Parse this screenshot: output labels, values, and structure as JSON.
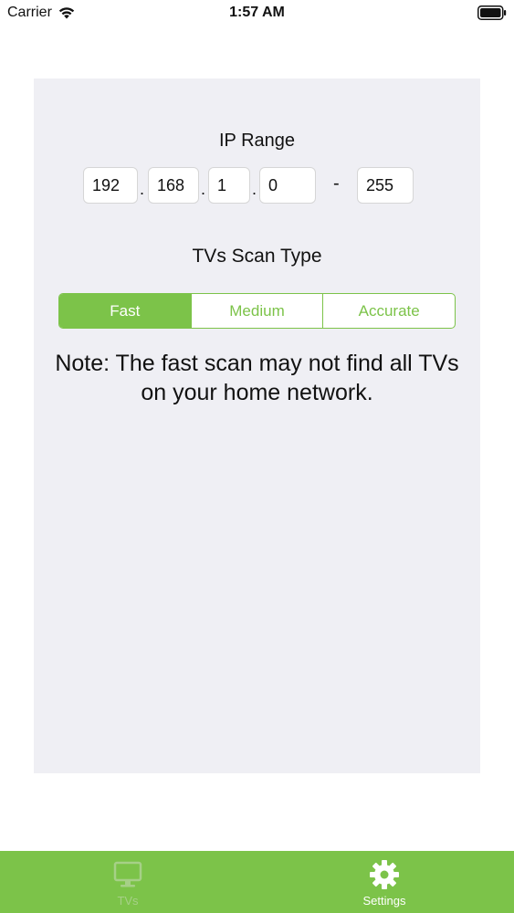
{
  "status_bar": {
    "carrier": "Carrier",
    "time": "1:57 AM"
  },
  "ip_range": {
    "title": "IP Range",
    "octet1": "192",
    "octet2": "168",
    "octet3": "1",
    "octet4": "0",
    "separator_dot": ".",
    "range_dash": "-",
    "range_end": "255"
  },
  "scan_type": {
    "title": "TVs Scan Type",
    "options": [
      "Fast",
      "Medium",
      "Accurate"
    ],
    "selected": "Fast"
  },
  "note": "Note: The fast scan may not find all TVs on your home network.",
  "tab_bar": {
    "tabs": [
      {
        "label": "TVs",
        "icon": "tv-icon",
        "active": false
      },
      {
        "label": "Settings",
        "icon": "gear-icon",
        "active": true
      }
    ]
  },
  "colors": {
    "accent": "#7cc349",
    "panel_background": "#efeff4",
    "inactive_tab": "#a6d087"
  }
}
